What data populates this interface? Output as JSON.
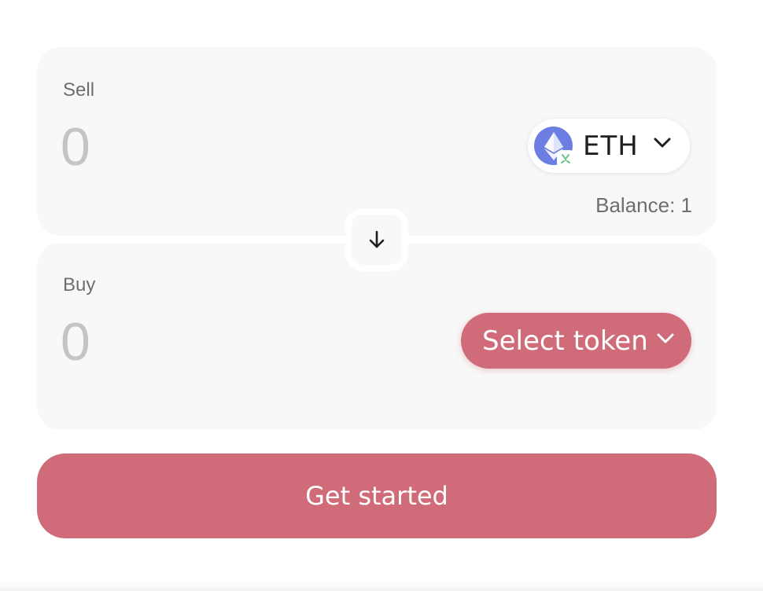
{
  "sell": {
    "label": "Sell",
    "amount_placeholder": "0",
    "token": {
      "symbol": "ETH",
      "icon": "ethereum-logo-icon",
      "chain_badge_icon": "chain-badge-icon"
    },
    "balance": "Balance: 1"
  },
  "swap": {
    "icon": "arrow-down-icon"
  },
  "buy": {
    "label": "Buy",
    "amount_placeholder": "0",
    "select_token_label": "Select token"
  },
  "cta": {
    "label": "Get started"
  },
  "colors": {
    "accent": "#d06c79",
    "panel_bg": "#f8f8f8",
    "eth_blue": "#6c7ee1",
    "badge_green": "#6bc38a",
    "muted_text": "#6e6e6e",
    "placeholder_text": "#c4c4c4"
  }
}
